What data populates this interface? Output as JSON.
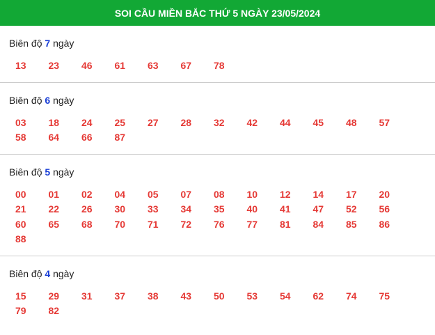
{
  "header": {
    "title": "SOI CẦU MIỀN BẮC THỨ 5 NGÀY 23/05/2024"
  },
  "colors": {
    "header_bg": "#12a835",
    "number": "#e53935",
    "day_count": "#1a3fd6"
  },
  "sections": [
    {
      "prefix": "Biên độ",
      "days": "7",
      "suffix": "ngày",
      "numbers": [
        "13",
        "23",
        "46",
        "61",
        "63",
        "67",
        "78"
      ]
    },
    {
      "prefix": "Biên độ",
      "days": "6",
      "suffix": "ngày",
      "numbers": [
        "03",
        "18",
        "24",
        "25",
        "27",
        "28",
        "32",
        "42",
        "44",
        "45",
        "48",
        "57",
        "58",
        "64",
        "66",
        "87"
      ]
    },
    {
      "prefix": "Biên độ",
      "days": "5",
      "suffix": "ngày",
      "numbers": [
        "00",
        "01",
        "02",
        "04",
        "05",
        "07",
        "08",
        "10",
        "12",
        "14",
        "17",
        "20",
        "21",
        "22",
        "26",
        "30",
        "33",
        "34",
        "35",
        "40",
        "41",
        "47",
        "52",
        "56",
        "60",
        "65",
        "68",
        "70",
        "71",
        "72",
        "76",
        "77",
        "81",
        "84",
        "85",
        "86",
        "88"
      ]
    },
    {
      "prefix": "Biên độ",
      "days": "4",
      "suffix": "ngày",
      "numbers": [
        "15",
        "29",
        "31",
        "37",
        "38",
        "43",
        "50",
        "53",
        "54",
        "62",
        "74",
        "75",
        "79",
        "82"
      ]
    }
  ]
}
